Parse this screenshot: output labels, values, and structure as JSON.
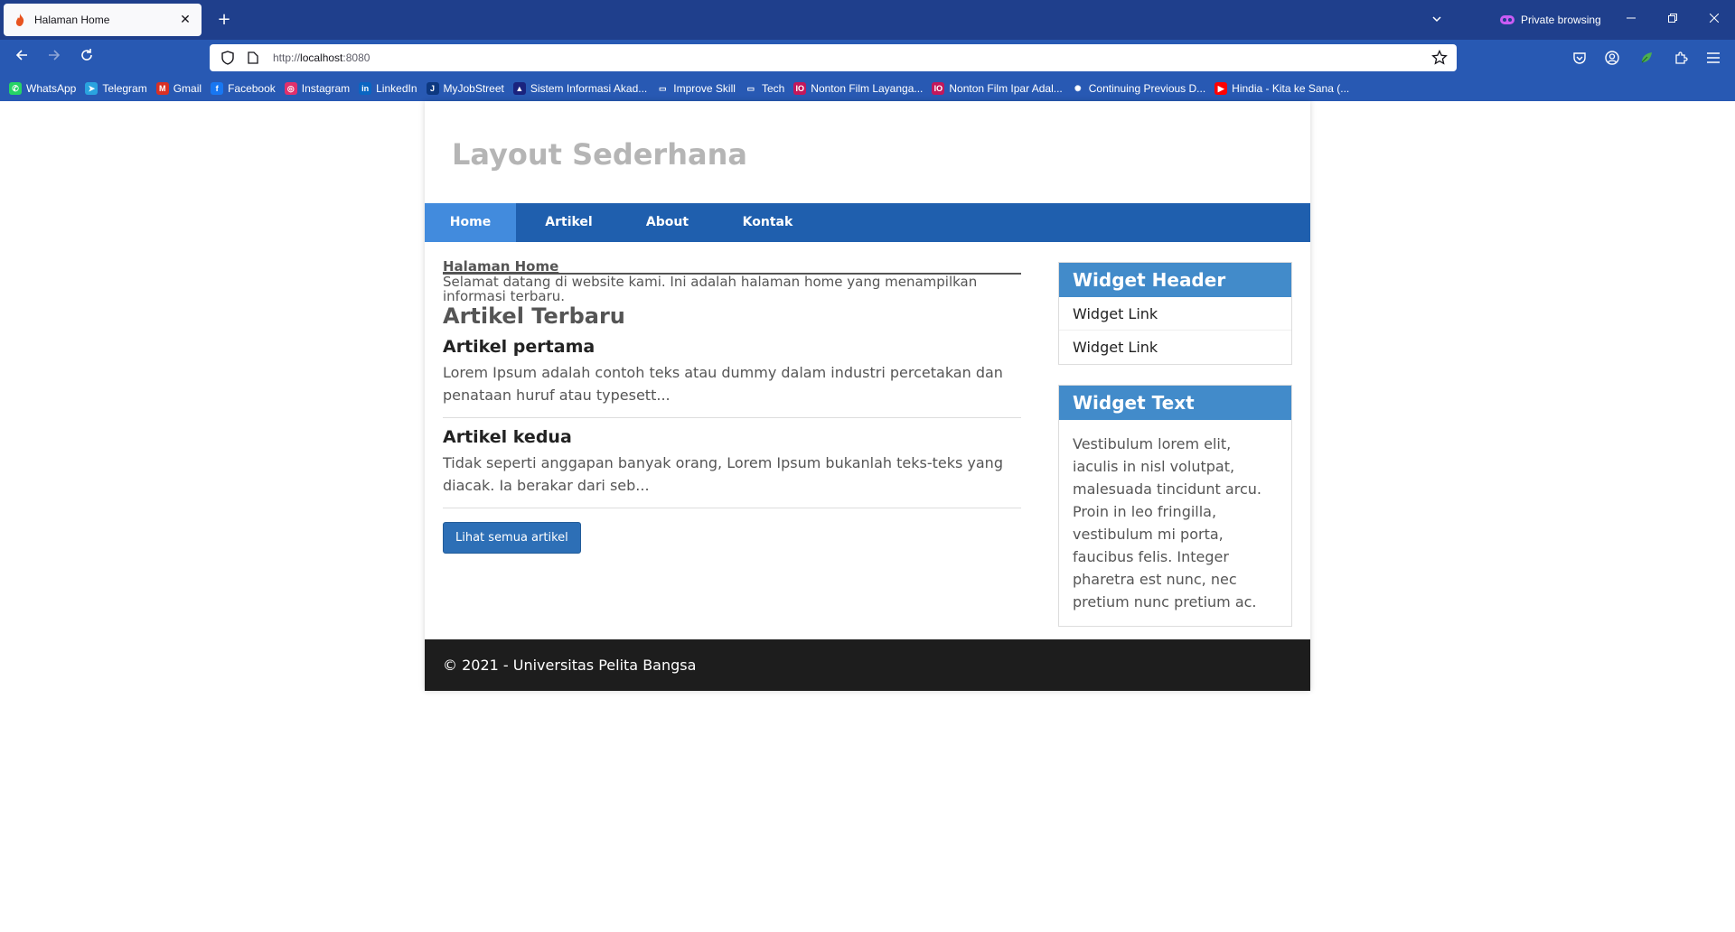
{
  "browser": {
    "tab_title": "Halaman Home",
    "tab_close": "✕",
    "new_tab": "+",
    "private_label": "Private browsing",
    "url_prefix": "http://",
    "url_host": "localhost",
    "url_suffix": ":8080",
    "bookmarks": [
      {
        "label": "WhatsApp",
        "color": "#25d366",
        "glyph": "✆"
      },
      {
        "label": "Telegram",
        "color": "#2aa3df",
        "glyph": "➤"
      },
      {
        "label": "Gmail",
        "color": "#d93025",
        "glyph": "M"
      },
      {
        "label": "Facebook",
        "color": "#1877f2",
        "glyph": "f"
      },
      {
        "label": "Instagram",
        "color": "#e1306c",
        "glyph": "◎"
      },
      {
        "label": "LinkedIn",
        "color": "#0a66c2",
        "glyph": "in"
      },
      {
        "label": "MyJobStreet",
        "color": "#0d3880",
        "glyph": "J"
      },
      {
        "label": "Sistem Informasi Akad...",
        "color": "#1a237e",
        "glyph": "▲"
      },
      {
        "label": "Improve Skill",
        "color": "transparent",
        "glyph": "▭"
      },
      {
        "label": "Tech",
        "color": "transparent",
        "glyph": "▭"
      },
      {
        "label": "Nonton Film Layanga...",
        "color": "#c2185b",
        "glyph": "IO"
      },
      {
        "label": "Nonton Film Ipar Adal...",
        "color": "#c2185b",
        "glyph": "IO"
      },
      {
        "label": "Continuing Previous D...",
        "color": "transparent",
        "glyph": "✺"
      },
      {
        "label": "Hindia - Kita ke Sana (...",
        "color": "#ff0000",
        "glyph": "▶"
      }
    ]
  },
  "site": {
    "title": "Layout Sederhana",
    "nav": [
      "Home",
      "Artikel",
      "About",
      "Kontak"
    ],
    "page_heading": "Halaman Home",
    "intro": "Selamat datang di website kami. Ini adalah halaman home yang menampilkan informasi terbaru.",
    "section_title": "Artikel Terbaru",
    "articles": [
      {
        "title": "Artikel pertama",
        "excerpt": "Lorem Ipsum adalah contoh teks atau dummy dalam industri percetakan dan penataan huruf atau typesett..."
      },
      {
        "title": "Artikel kedua",
        "excerpt": "Tidak seperti anggapan banyak orang, Lorem Ipsum bukanlah teks-teks yang diacak. Ia berakar dari seb..."
      }
    ],
    "all_articles_button": "Lihat semua artikel",
    "widget_header": {
      "title": "Widget Header",
      "links": [
        "Widget Link",
        "Widget Link"
      ]
    },
    "widget_text": {
      "title": "Widget Text",
      "body": "Vestibulum lorem elit, iaculis in nisl volutpat, malesuada tincidunt arcu. Proin in leo fringilla, vestibulum mi porta, faucibus felis. Integer pharetra est nunc, nec pretium nunc pretium ac."
    },
    "footer": "© 2021 - Universitas Pelita Bangsa"
  },
  "colors": {
    "tabbar": "#1f3f8c",
    "toolbar": "#2859b3",
    "nav": "#1f5fae",
    "nav_active": "#428bdd",
    "widget_head": "#428bca",
    "footer": "#1d1d1d",
    "button": "#2d6fb6"
  }
}
